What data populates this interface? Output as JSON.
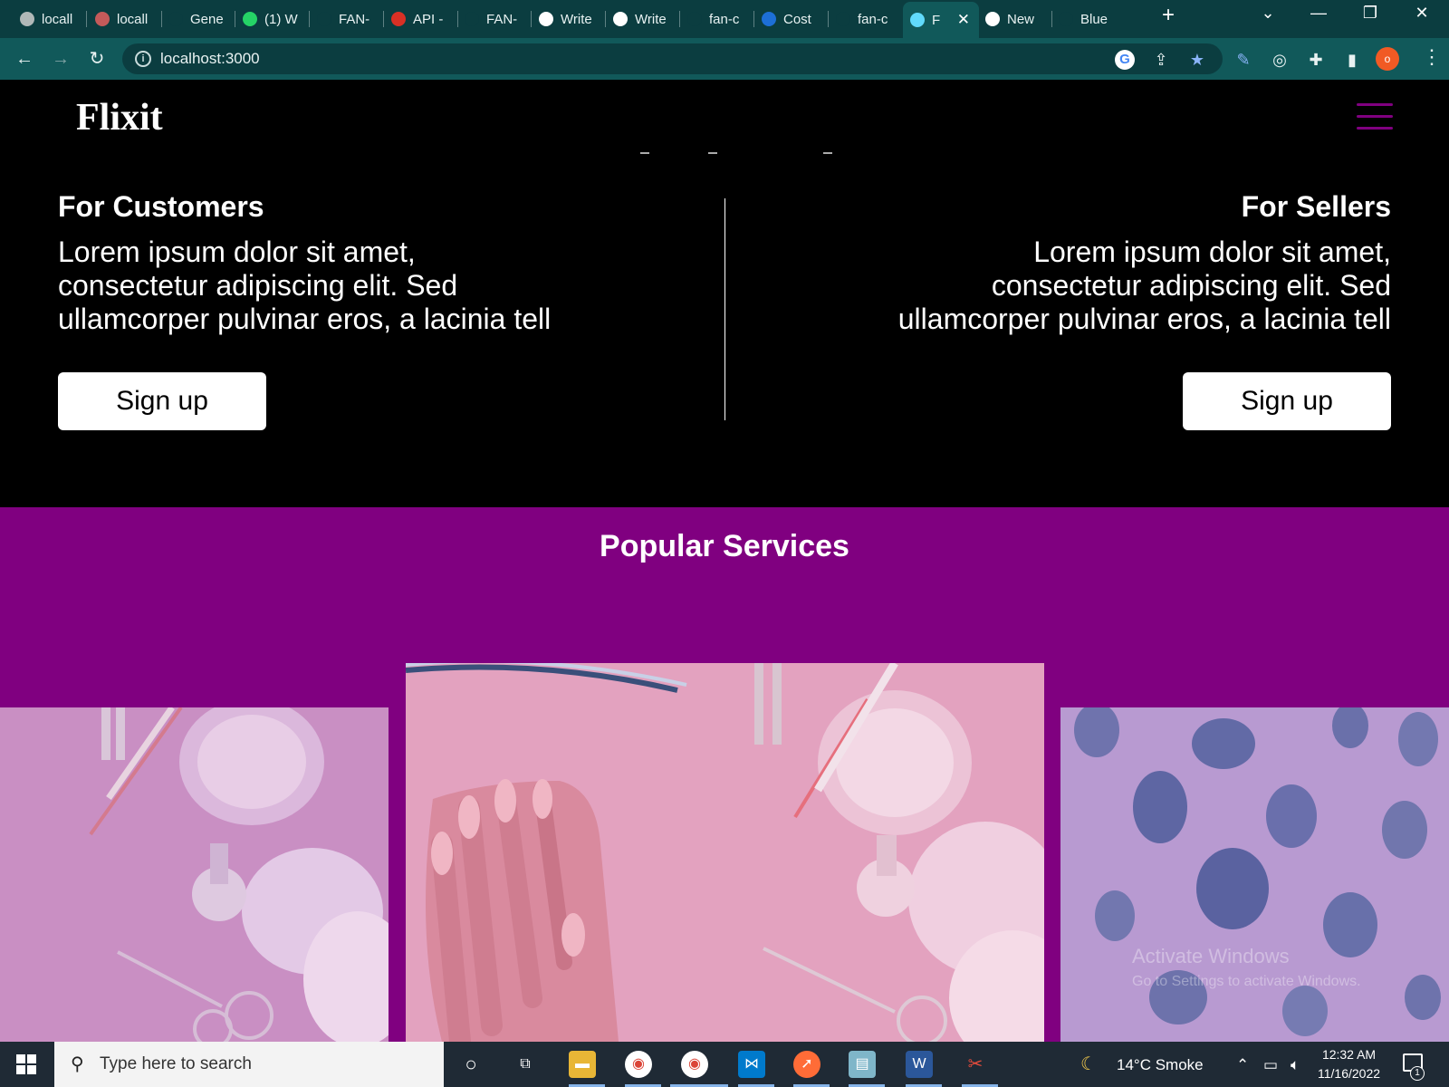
{
  "browser": {
    "tabs": [
      {
        "label": "locall",
        "icon": "globe-icon",
        "color": "#b0b8b8"
      },
      {
        "label": "locall",
        "icon": "react-icon",
        "color": "#c45a5a"
      },
      {
        "label": "Gene",
        "icon": "github-icon",
        "color": "#0b3d40"
      },
      {
        "label": "(1) W",
        "icon": "whatsapp-icon",
        "color": "#25d366"
      },
      {
        "label": "FAN-",
        "icon": "github-icon",
        "color": "#0b3d40"
      },
      {
        "label": "API -",
        "icon": "gmail-icon",
        "color": "#d93025"
      },
      {
        "label": "FAN-",
        "icon": "github-icon",
        "color": "#0b3d40"
      },
      {
        "label": "Write",
        "icon": "globe-icon",
        "color": "#ffffff"
      },
      {
        "label": "Write",
        "icon": "globe-icon",
        "color": "#ffffff"
      },
      {
        "label": "fan-c",
        "icon": "github-icon",
        "color": "#0b3d40"
      },
      {
        "label": "Cost",
        "icon": "bird-icon",
        "color": "#1d6fd6"
      },
      {
        "label": "fan-c",
        "icon": "github-icon",
        "color": "#0b3d40"
      },
      {
        "label": "F",
        "icon": "react-icon",
        "color": "#61dafb",
        "active": true
      },
      {
        "label": "New",
        "icon": "chrome-icon",
        "color": "#ffffff"
      },
      {
        "label": "Blue",
        "icon": "circle-icon",
        "color": "#0b3d40"
      }
    ],
    "url": "localhost:3000",
    "profile_initial": "o"
  },
  "page": {
    "logo": "Flixit",
    "accent_color": "#800080",
    "customers": {
      "heading": "For Customers",
      "body": "Lorem ipsum dolor sit amet, consectetur adipiscing elit. Sed ullamcorper pulvinar eros, a lacinia tell",
      "button": "Sign up"
    },
    "sellers": {
      "heading": "For Sellers",
      "body": "Lorem ipsum dolor sit amet, consectetur adipiscing elit. Sed ullamcorper pulvinar eros, a lacinia tell",
      "button": "Sign up"
    },
    "services_title": "Popular Services"
  },
  "watermark": {
    "line1": "Activate Windows",
    "line2": "Go to Settings to activate Windows."
  },
  "taskbar": {
    "search_placeholder": "Type here to search",
    "weather": "14°C  Smoke",
    "time": "12:32 AM",
    "date": "11/16/2022",
    "notification_count": "1"
  }
}
